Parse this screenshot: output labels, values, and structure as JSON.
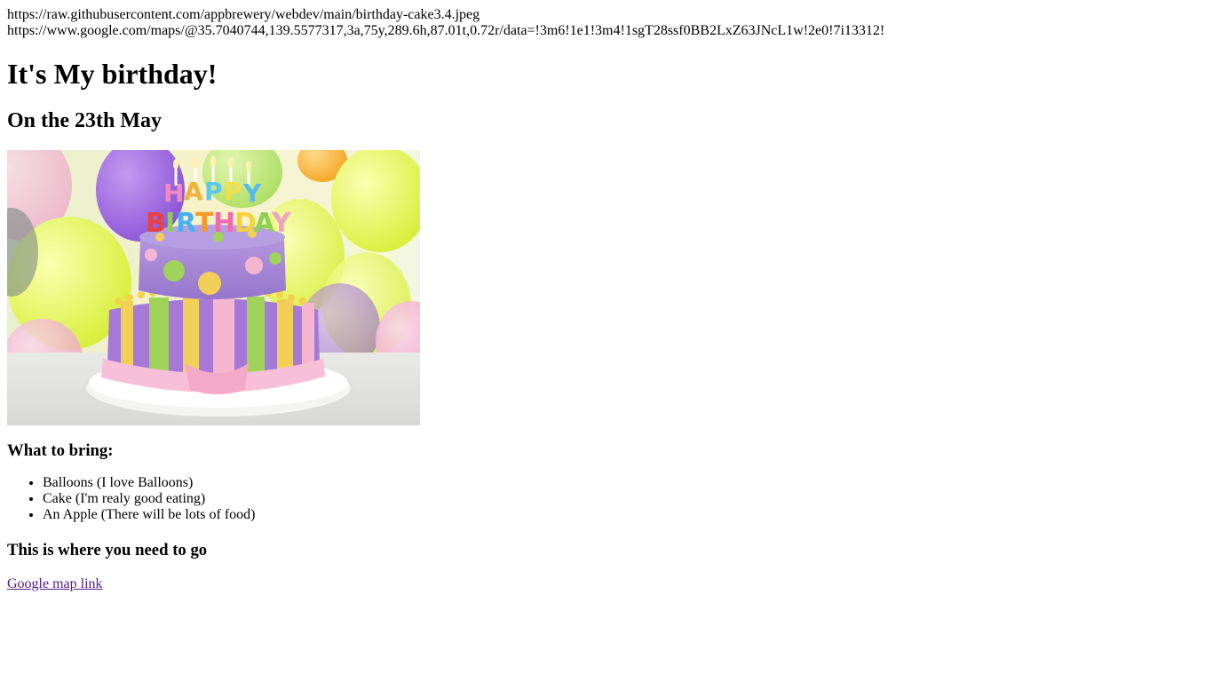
{
  "urls": {
    "image": "https://raw.githubusercontent.com/appbrewery/webdev/main/birthday-cake3.4.jpeg",
    "map": "https://www.google.com/maps/@35.7040744,139.5577317,3a,75y,289.6h,87.01t,0.72r/data=!3m6!1e1!3m4!1sgT28ssf0BB2LxZ63JNcL1w!2e0!7i13312!"
  },
  "heading": "It's My birthday!",
  "subheading": "On the 23th May",
  "bring": {
    "title": "What to bring:",
    "items": [
      "Balloons (I love Balloons)",
      "Cake (I'm realy good eating)",
      "An Apple (There will be lots of food)"
    ]
  },
  "location": {
    "title": "This is where you need to go",
    "link_text": "Google map link"
  },
  "colors": {
    "visited_link": "#551a8b"
  }
}
